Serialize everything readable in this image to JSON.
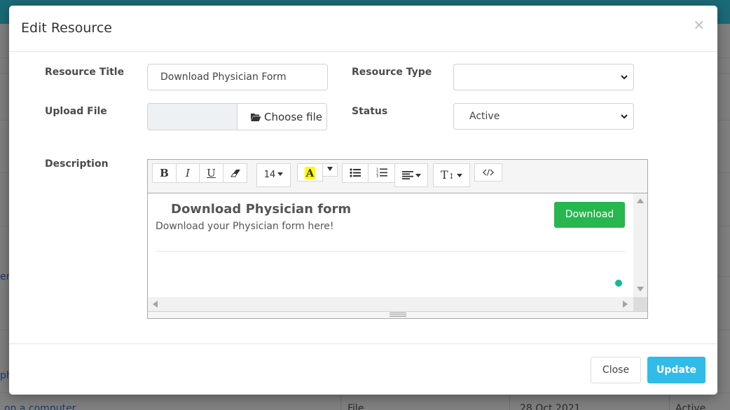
{
  "modal": {
    "title": "Edit Resource",
    "close_icon": "×"
  },
  "form": {
    "resource_title_label": "Resource Title",
    "resource_title_value": "Download Physician Form",
    "resource_type_label": "Resource Type",
    "resource_type_value": "",
    "upload_file_label": "Upload File",
    "choose_file_label": "Choose file",
    "status_label": "Status",
    "status_value": "Active",
    "description_label": "Description"
  },
  "editor": {
    "toolbar": {
      "bold": "B",
      "italic": "I",
      "underline": "U",
      "font_size": "14",
      "highlight": "A",
      "style": "T"
    },
    "content": {
      "heading": "Download Physician form",
      "subtext": "Download your Physician form here!",
      "button_label": "Download"
    }
  },
  "footer": {
    "close_label": "Close",
    "update_label": "Update"
  },
  "background": {
    "link_fragment_1": "er",
    "link_fragment_2": "ph",
    "bottom_link": "on a computer",
    "type_cell": "File",
    "date_cell": "28 Oct 2021",
    "status_cell": "Active"
  },
  "colors": {
    "download_button": "#28b64f",
    "update_button": "#30bce9",
    "status_dot": "#17b890"
  }
}
